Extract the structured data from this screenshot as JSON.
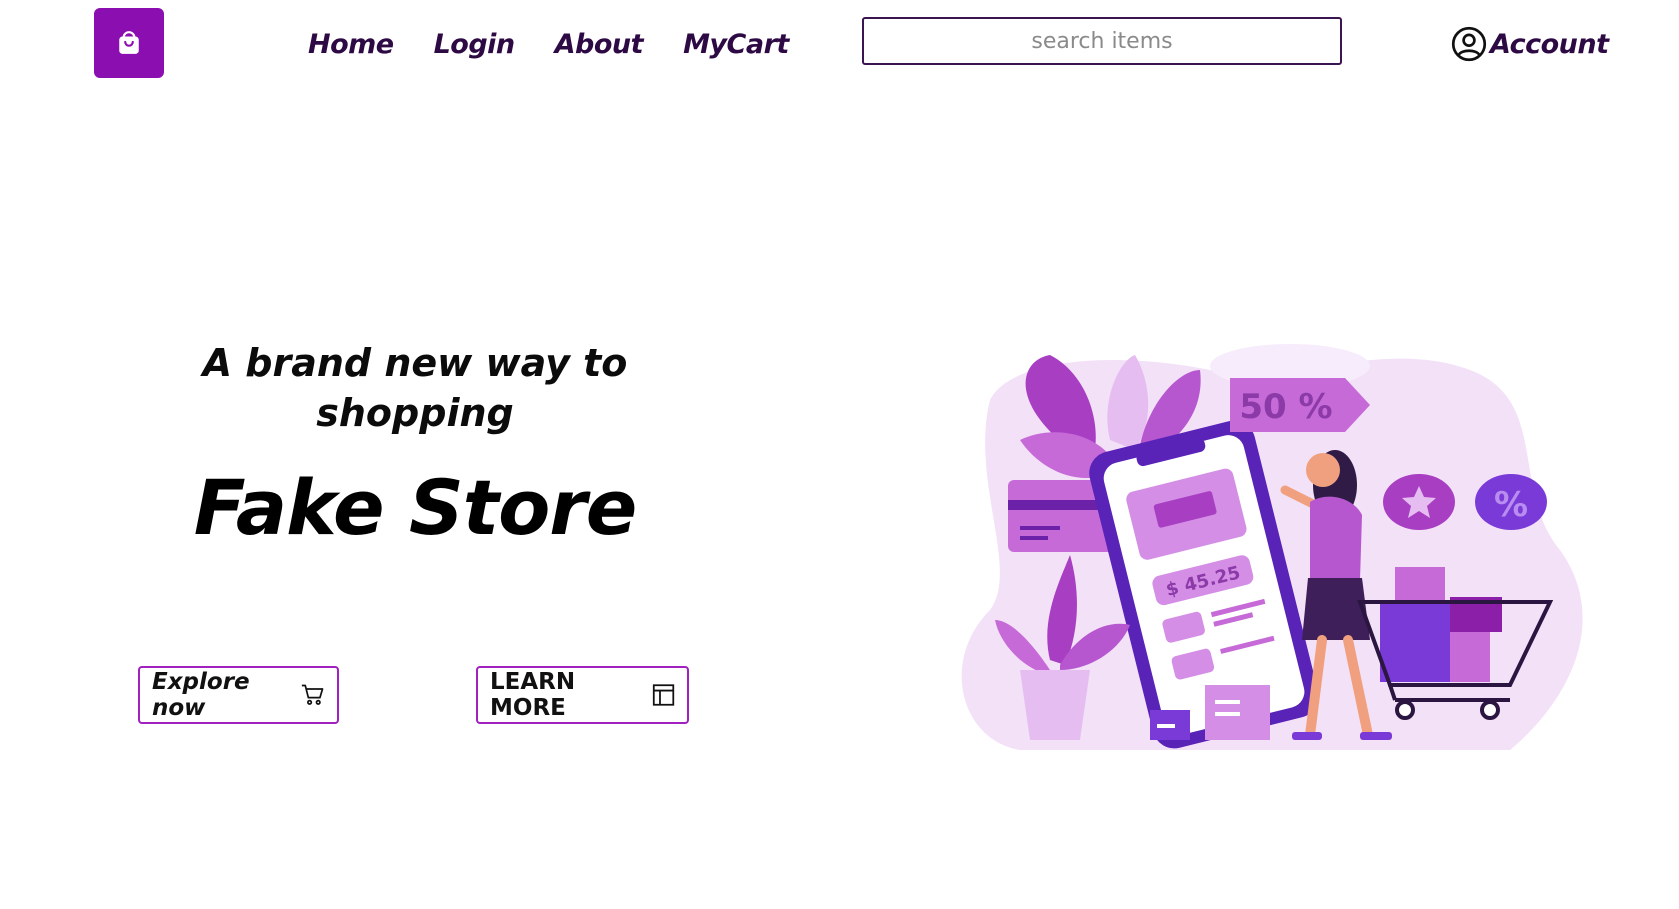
{
  "header": {
    "logo_icon": "shopping-bag-icon",
    "nav": [
      "Home",
      "Login",
      "About",
      "MyCart"
    ],
    "search_placeholder": "search items",
    "account_label": "Account",
    "account_icon": "user-circle-icon"
  },
  "hero": {
    "tagline": "A brand new way to shopping",
    "title": "Fake Store",
    "explore_label": "Explore now",
    "explore_icon": "cart-icon",
    "learn_label": "LEARN MORE",
    "learn_icon": "layout-icon"
  },
  "illustration": {
    "discount_tag": "50 %",
    "price": "$ 45.25",
    "percent_badge": "%"
  },
  "colors": {
    "brand": "#8b0fb0",
    "nav_text": "#2e0a45",
    "button_border": "#a020c0",
    "illustration_light": "#f1dcf7",
    "illustration_mid": "#c86fe0",
    "illustration_dark": "#5a23b8"
  }
}
